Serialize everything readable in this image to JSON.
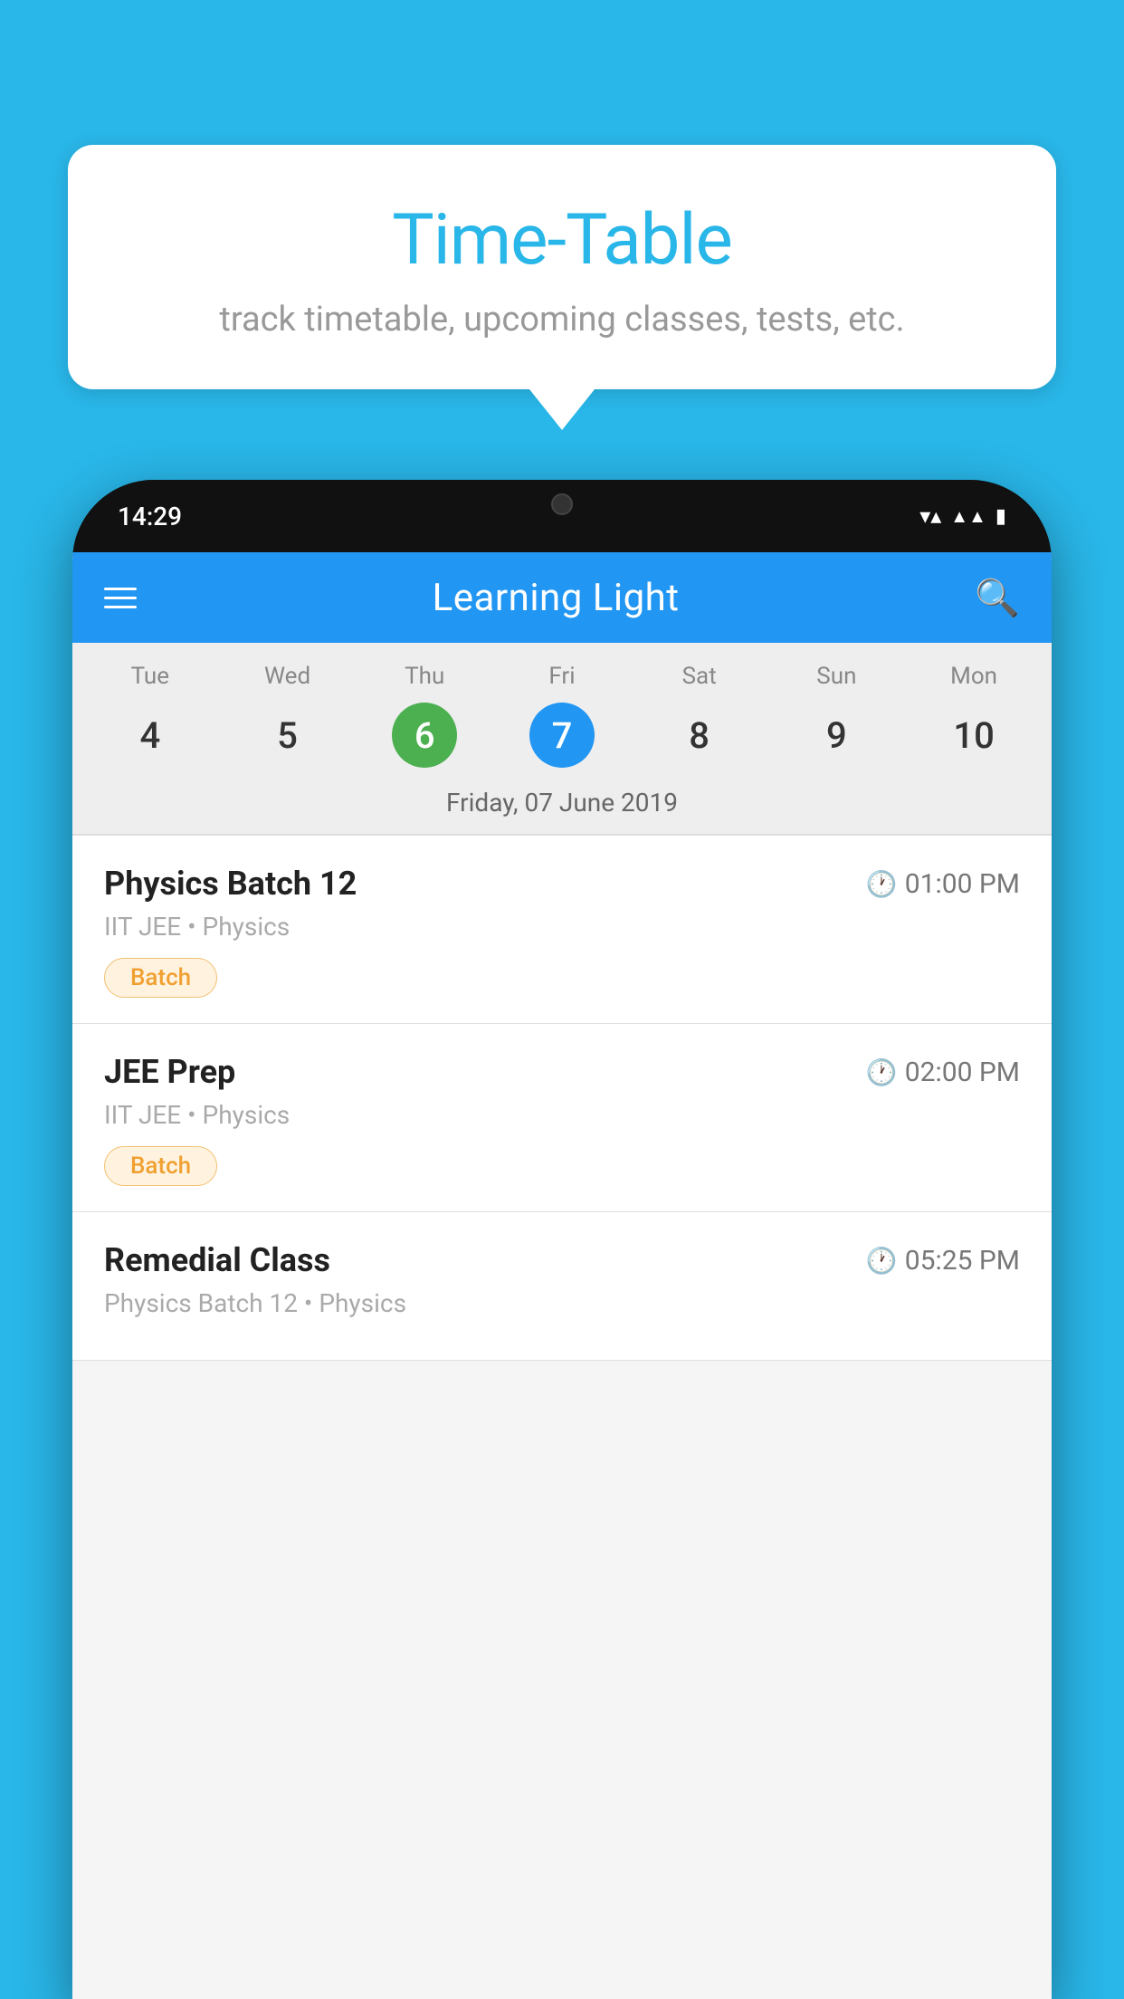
{
  "background_color": "#29b6e8",
  "tooltip": {
    "title": "Time-Table",
    "subtitle": "track timetable, upcoming classes, tests, etc."
  },
  "phone": {
    "status_bar": {
      "time": "14:29",
      "wifi": "▼▲",
      "battery": "▮"
    },
    "header": {
      "title": "Learning Light",
      "menu_label": "menu",
      "search_label": "search"
    },
    "calendar": {
      "days": [
        {
          "name": "Tue",
          "num": "4",
          "state": "normal"
        },
        {
          "name": "Wed",
          "num": "5",
          "state": "normal"
        },
        {
          "name": "Thu",
          "num": "6",
          "state": "today"
        },
        {
          "name": "Fri",
          "num": "7",
          "state": "selected"
        },
        {
          "name": "Sat",
          "num": "8",
          "state": "normal"
        },
        {
          "name": "Sun",
          "num": "9",
          "state": "normal"
        },
        {
          "name": "Mon",
          "num": "10",
          "state": "normal"
        }
      ],
      "selected_date_label": "Friday, 07 June 2019"
    },
    "classes": [
      {
        "name": "Physics Batch 12",
        "time": "01:00 PM",
        "details": "IIT JEE • Physics",
        "badge": "Batch"
      },
      {
        "name": "JEE Prep",
        "time": "02:00 PM",
        "details": "IIT JEE • Physics",
        "badge": "Batch"
      },
      {
        "name": "Remedial Class",
        "time": "05:25 PM",
        "details": "Physics Batch 12 • Physics",
        "badge": ""
      }
    ]
  }
}
